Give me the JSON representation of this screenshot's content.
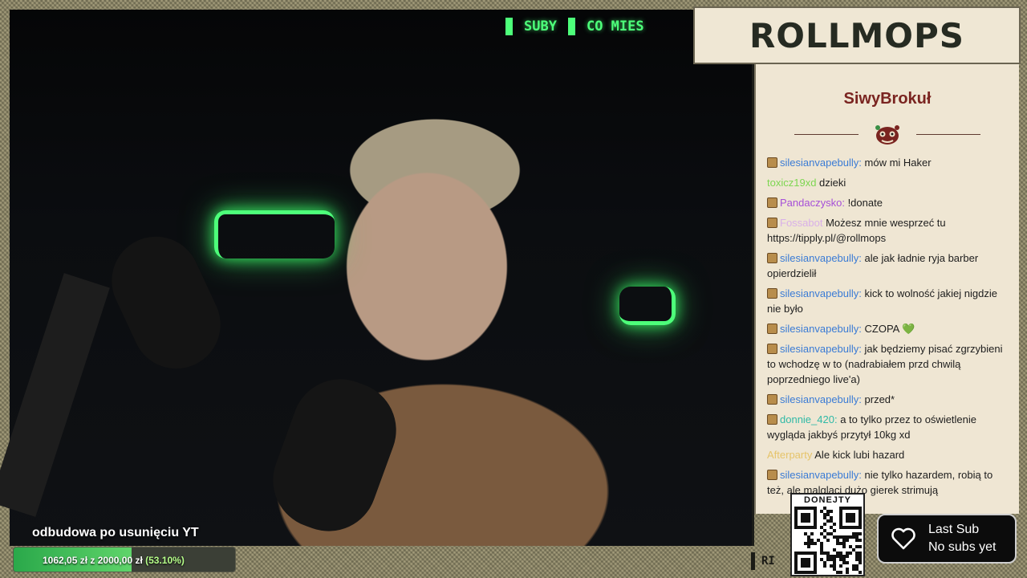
{
  "ticker": {
    "items": [
      "SUBY",
      "CO MIES"
    ]
  },
  "brand": {
    "title": "ROLLMOPS",
    "color": "#262b22"
  },
  "chat": {
    "streamer": "SiwyBrokuł",
    "messages": [
      {
        "user": "silesianvapebully",
        "suffix": ":",
        "text": " mów mi Haker",
        "color": "#3a7bd5",
        "badge": true
      },
      {
        "user": "toxicz19xd",
        "suffix": "",
        "text": " dzieki",
        "color": "#7dd651",
        "badge": false
      },
      {
        "user": "Pandaczysko",
        "suffix": ":",
        "text": " !donate",
        "color": "#a64fd8",
        "badge": true
      },
      {
        "user": "Fossabot",
        "suffix": "",
        "text": " Możesz mnie wesprzeć tu https://tipply.pl/@rollmops",
        "color": "#d9b0e8",
        "badge": true
      },
      {
        "user": "silesianvapebully",
        "suffix": ":",
        "text": " ale jak ładnie ryja barber opierdzielił",
        "color": "#3a7bd5",
        "badge": true
      },
      {
        "user": "silesianvapebully",
        "suffix": ":",
        "text": " kick to wolność jakiej nigdzie nie było",
        "color": "#3a7bd5",
        "badge": true
      },
      {
        "user": "silesianvapebully",
        "suffix": ":",
        "text": " CZOPA 💚",
        "color": "#3a7bd5",
        "badge": true
      },
      {
        "user": "silesianvapebully",
        "suffix": ":",
        "text": " jak będziemy pisać zgrzybieni to wchodzę w to (nadrabiałem przd chwilą poprzedniego live'a)",
        "color": "#3a7bd5",
        "badge": true
      },
      {
        "user": "silesianvapebully",
        "suffix": ":",
        "text": " przed*",
        "color": "#3a7bd5",
        "badge": true
      },
      {
        "user": "donnie_420",
        "suffix": ":",
        "text": " a to tylko przez to oświetlenie wygląda jakbyś przytył 10kg xd",
        "color": "#2fb9a6",
        "badge": true
      },
      {
        "user": "Afterparty",
        "suffix": "",
        "text": " Ale kick lubi hazard",
        "color": "#e6c46a",
        "badge": false
      },
      {
        "user": "silesianvapebully",
        "suffix": ":",
        "text": " nie tylko hazardem, robią to też, ale malglacj dużo gierek strimują",
        "color": "#3a7bd5",
        "badge": true
      }
    ]
  },
  "qr": {
    "label": "DONEJTY"
  },
  "last_sub": {
    "title": "Last Sub",
    "value": "No subs yet"
  },
  "goal": {
    "title": "odbudowa po usunięciu YT",
    "current": "1062,05 zł",
    "separator": "z",
    "target": "2000,00 zł",
    "percent_text": "(53.10%)",
    "fraction": 0.531
  },
  "overlay_mark": {
    "text": "RI"
  }
}
